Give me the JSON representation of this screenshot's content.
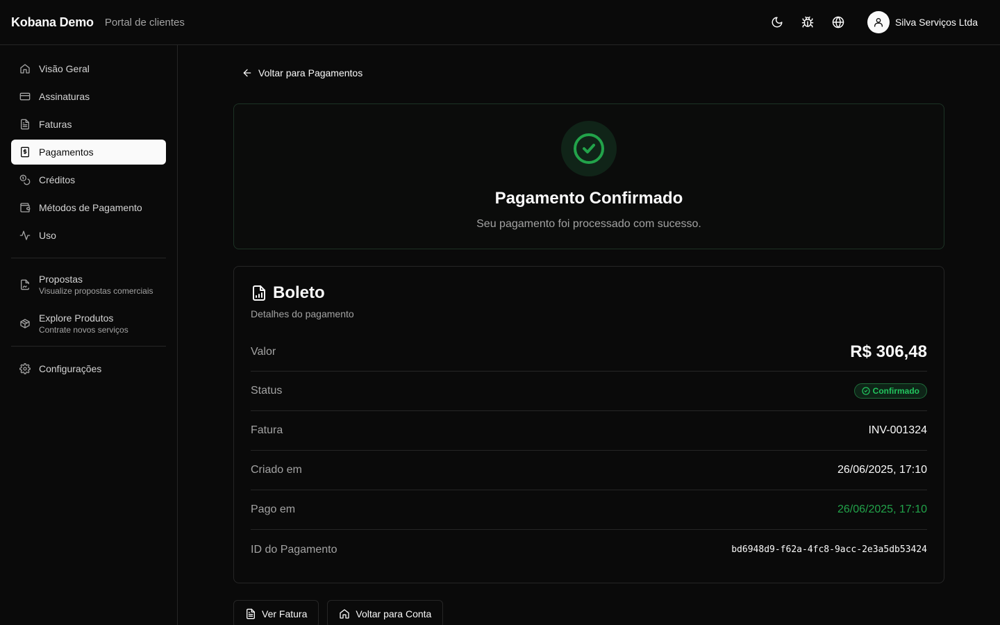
{
  "header": {
    "brand": "Kobana Demo",
    "subtitle": "Portal de clientes",
    "icons": [
      "moon-icon",
      "bug-icon",
      "globe-icon"
    ],
    "user_name": "Silva Serviços Ltda"
  },
  "sidebar": {
    "items": [
      {
        "label": "Visão Geral",
        "icon": "home-icon"
      },
      {
        "label": "Assinaturas",
        "icon": "credit-card-icon"
      },
      {
        "label": "Faturas",
        "icon": "file-text-icon"
      },
      {
        "label": "Pagamentos",
        "icon": "receipt-dollar-icon",
        "active": true
      },
      {
        "label": "Créditos",
        "icon": "coins-icon"
      },
      {
        "label": "Métodos de Pagamento",
        "icon": "wallet-icon"
      },
      {
        "label": "Uso",
        "icon": "activity-icon"
      }
    ],
    "extra": [
      {
        "title": "Propostas",
        "subtitle": "Visualize propostas comerciais",
        "icon": "file-signature-icon"
      },
      {
        "title": "Explore Produtos",
        "subtitle": "Contrate novos serviços",
        "icon": "package-icon"
      }
    ],
    "settings_label": "Configurações"
  },
  "main": {
    "back_label": "Voltar para Pagamentos",
    "success": {
      "title": "Pagamento Confirmado",
      "subtitle": "Seu pagamento foi processado com sucesso."
    },
    "details": {
      "title": "Boleto",
      "subtitle": "Detalhes do pagamento",
      "rows": [
        {
          "label": "Valor",
          "value": "R$ 306,48"
        },
        {
          "label": "Status",
          "value": "Confirmado"
        },
        {
          "label": "Fatura",
          "value": "INV-001324"
        },
        {
          "label": "Criado em",
          "value": "26/06/2025, 17:10"
        },
        {
          "label": "Pago em",
          "value": "26/06/2025, 17:10"
        },
        {
          "label": "ID do Pagamento",
          "value": "bd6948d9-f62a-4fc8-9acc-2e3a5db53424"
        }
      ]
    },
    "buttons": {
      "view_invoice": "Ver Fatura",
      "back_account": "Voltar para Conta"
    }
  },
  "colors": {
    "background": "#0a0a0a",
    "success_green": "#22c55e",
    "paid_green": "#22a34a",
    "border": "#262626"
  }
}
